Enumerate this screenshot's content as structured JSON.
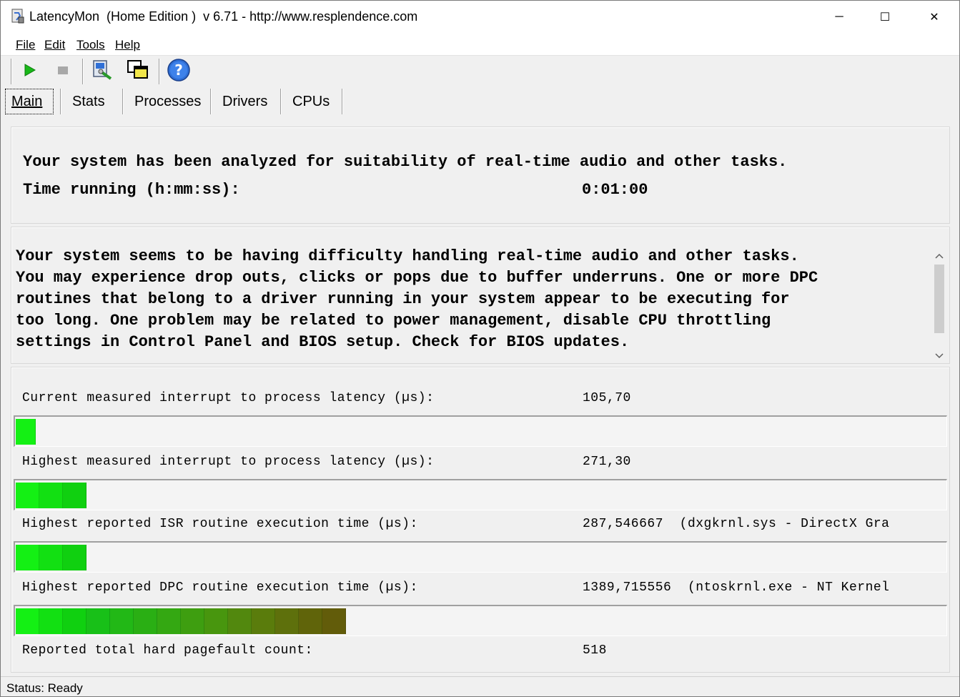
{
  "window": {
    "title": "LatencyMon  (Home Edition )  v 6.71 - http://www.resplendence.com",
    "minimize_glyph": "─",
    "maximize_glyph": "☐",
    "close_glyph": "✕"
  },
  "menu": [
    "File",
    "Edit",
    "Tools",
    "Help"
  ],
  "toolbar": {
    "icons": [
      "play-icon",
      "stop-icon",
      "system-info-icon",
      "windows-icon",
      "help-icon"
    ]
  },
  "tabs": [
    "Main",
    "Stats",
    "Processes",
    "Drivers",
    "CPUs"
  ],
  "summary": {
    "line1": "Your system has been analyzed for suitability of real-time audio and other tasks.",
    "time_label": "Time running (h:mm:ss):",
    "time_value": "0:01:00"
  },
  "warning": {
    "lines": [
      "Your system seems to be having difficulty handling real-time audio and other tasks.",
      "You may experience drop outs, clicks or pops due to buffer underruns. One or more DPC",
      "routines that belong to a driver running in your system appear to be executing for",
      "too long. One problem may be related to power management, disable CPU throttling",
      "settings in Control Panel and BIOS setup. Check for BIOS updates."
    ]
  },
  "metrics": [
    {
      "label": "Current measured interrupt to process latency (µs):",
      "value": "105,70",
      "detail": "",
      "segments": 1
    },
    {
      "label": "Highest measured interrupt to process latency (µs):",
      "value": "271,30",
      "detail": "",
      "segments": 3
    },
    {
      "label": "Highest reported ISR routine execution time (µs):",
      "value": "287,546667",
      "detail": "(dxgkrnl.sys - DirectX Gra",
      "segments": 3
    },
    {
      "label": "Highest reported DPC routine execution time (µs):",
      "value": "1389,715556",
      "detail": "(ntoskrnl.exe - NT Kernel",
      "segments": 14
    }
  ],
  "pagefault": {
    "label": "Reported total hard pagefault count:",
    "value": "518"
  },
  "status": {
    "text": "Status: Ready"
  }
}
